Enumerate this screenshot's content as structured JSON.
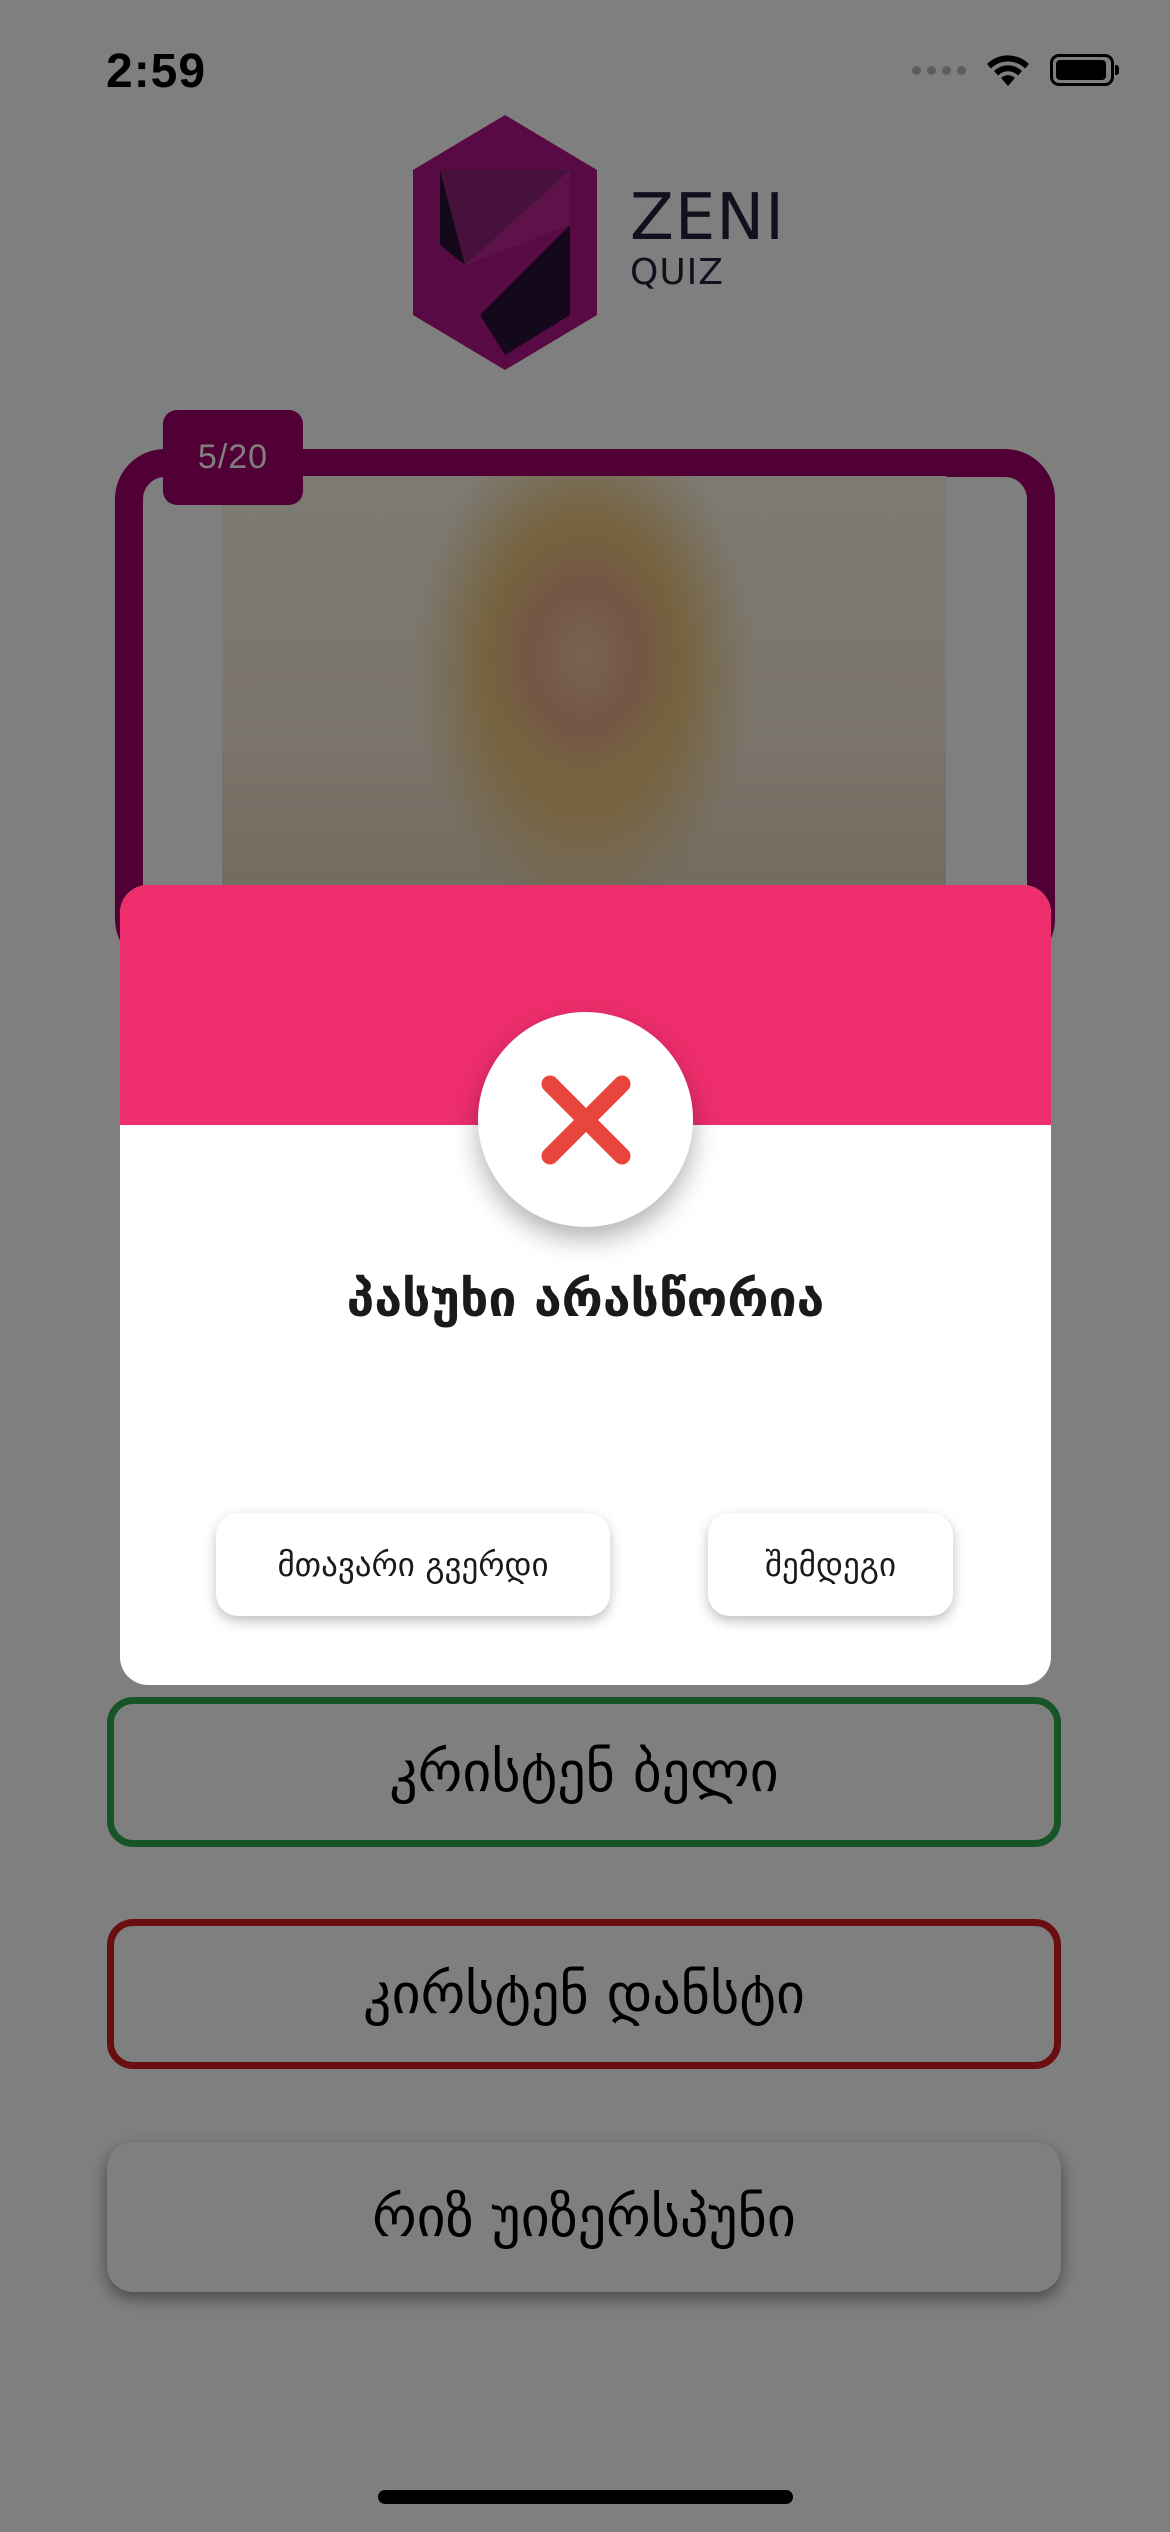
{
  "status_bar": {
    "time": "2:59"
  },
  "logo": {
    "title": "ZENI",
    "subtitle": "QUIZ"
  },
  "question": {
    "counter": "5/20"
  },
  "answers": [
    {
      "label": "კრისტენ ბელი",
      "state": "correct"
    },
    {
      "label": "კირსტენ დანსტი",
      "state": "wrong"
    },
    {
      "label": "რიზ უიზერსპუნი",
      "state": "neutral"
    }
  ],
  "dialog": {
    "title": "პასუხი არასწორია",
    "main_button": "მთავარი გვერდი",
    "next_button": "შემდეგი",
    "icon": "close-icon"
  },
  "colors": {
    "brand": "#a3006d",
    "dialog_header": "#ee2e6c",
    "error_icon": "#e8453c",
    "correct": "#2fa84f",
    "wrong": "#d31c23"
  }
}
